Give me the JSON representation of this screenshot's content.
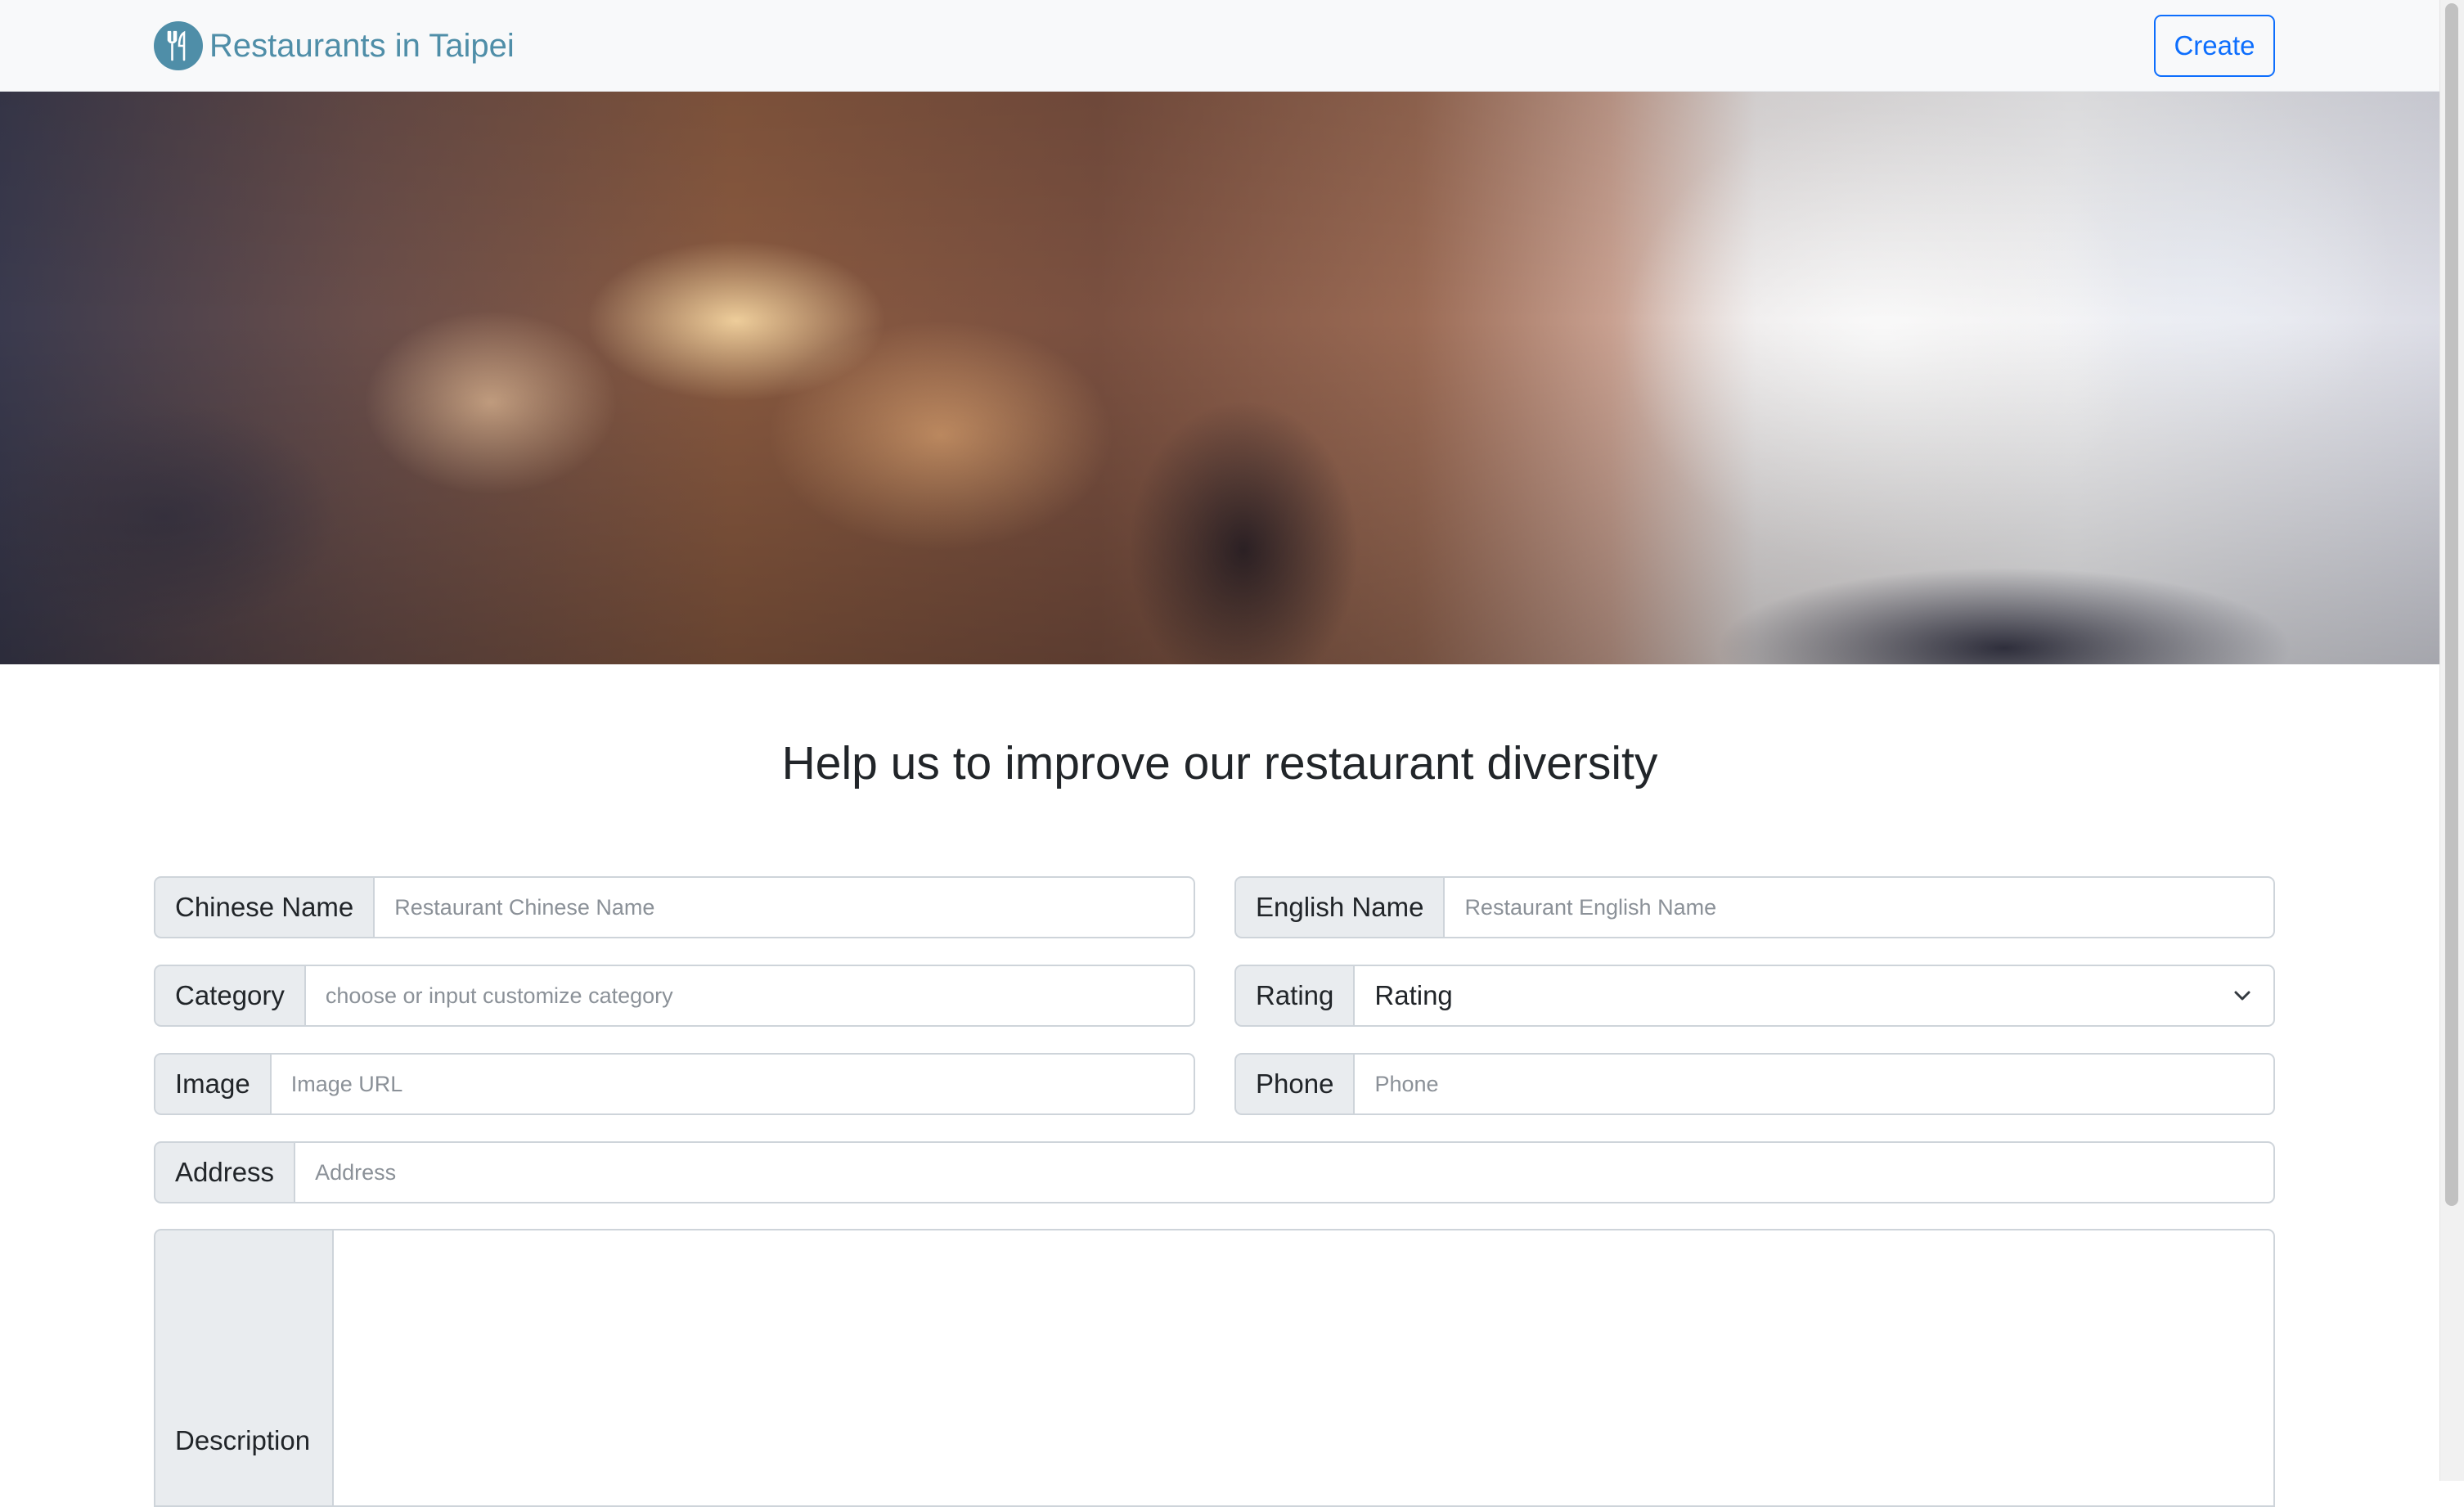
{
  "navbar": {
    "brand_text": "Restaurants in Taipei",
    "logo_icon": "fork-knife-icon",
    "create_button": "Create",
    "brand_color": "#4f8ea8",
    "accent_color": "#0d6efd"
  },
  "main": {
    "heading": "Help us to improve our restaurant diversity"
  },
  "form": {
    "chinese_name": {
      "label": "Chinese Name",
      "placeholder": "Restaurant Chinese Name",
      "value": ""
    },
    "english_name": {
      "label": "English Name",
      "placeholder": "Restaurant English Name",
      "value": ""
    },
    "category": {
      "label": "Category",
      "placeholder": "choose or input customize category",
      "value": ""
    },
    "rating": {
      "label": "Rating",
      "selected": "Rating"
    },
    "image": {
      "label": "Image",
      "placeholder": "Image URL",
      "value": ""
    },
    "phone": {
      "label": "Phone",
      "placeholder": "Phone",
      "value": ""
    },
    "address": {
      "label": "Address",
      "placeholder": "Address",
      "value": ""
    },
    "description": {
      "label": "Description",
      "value": ""
    }
  }
}
